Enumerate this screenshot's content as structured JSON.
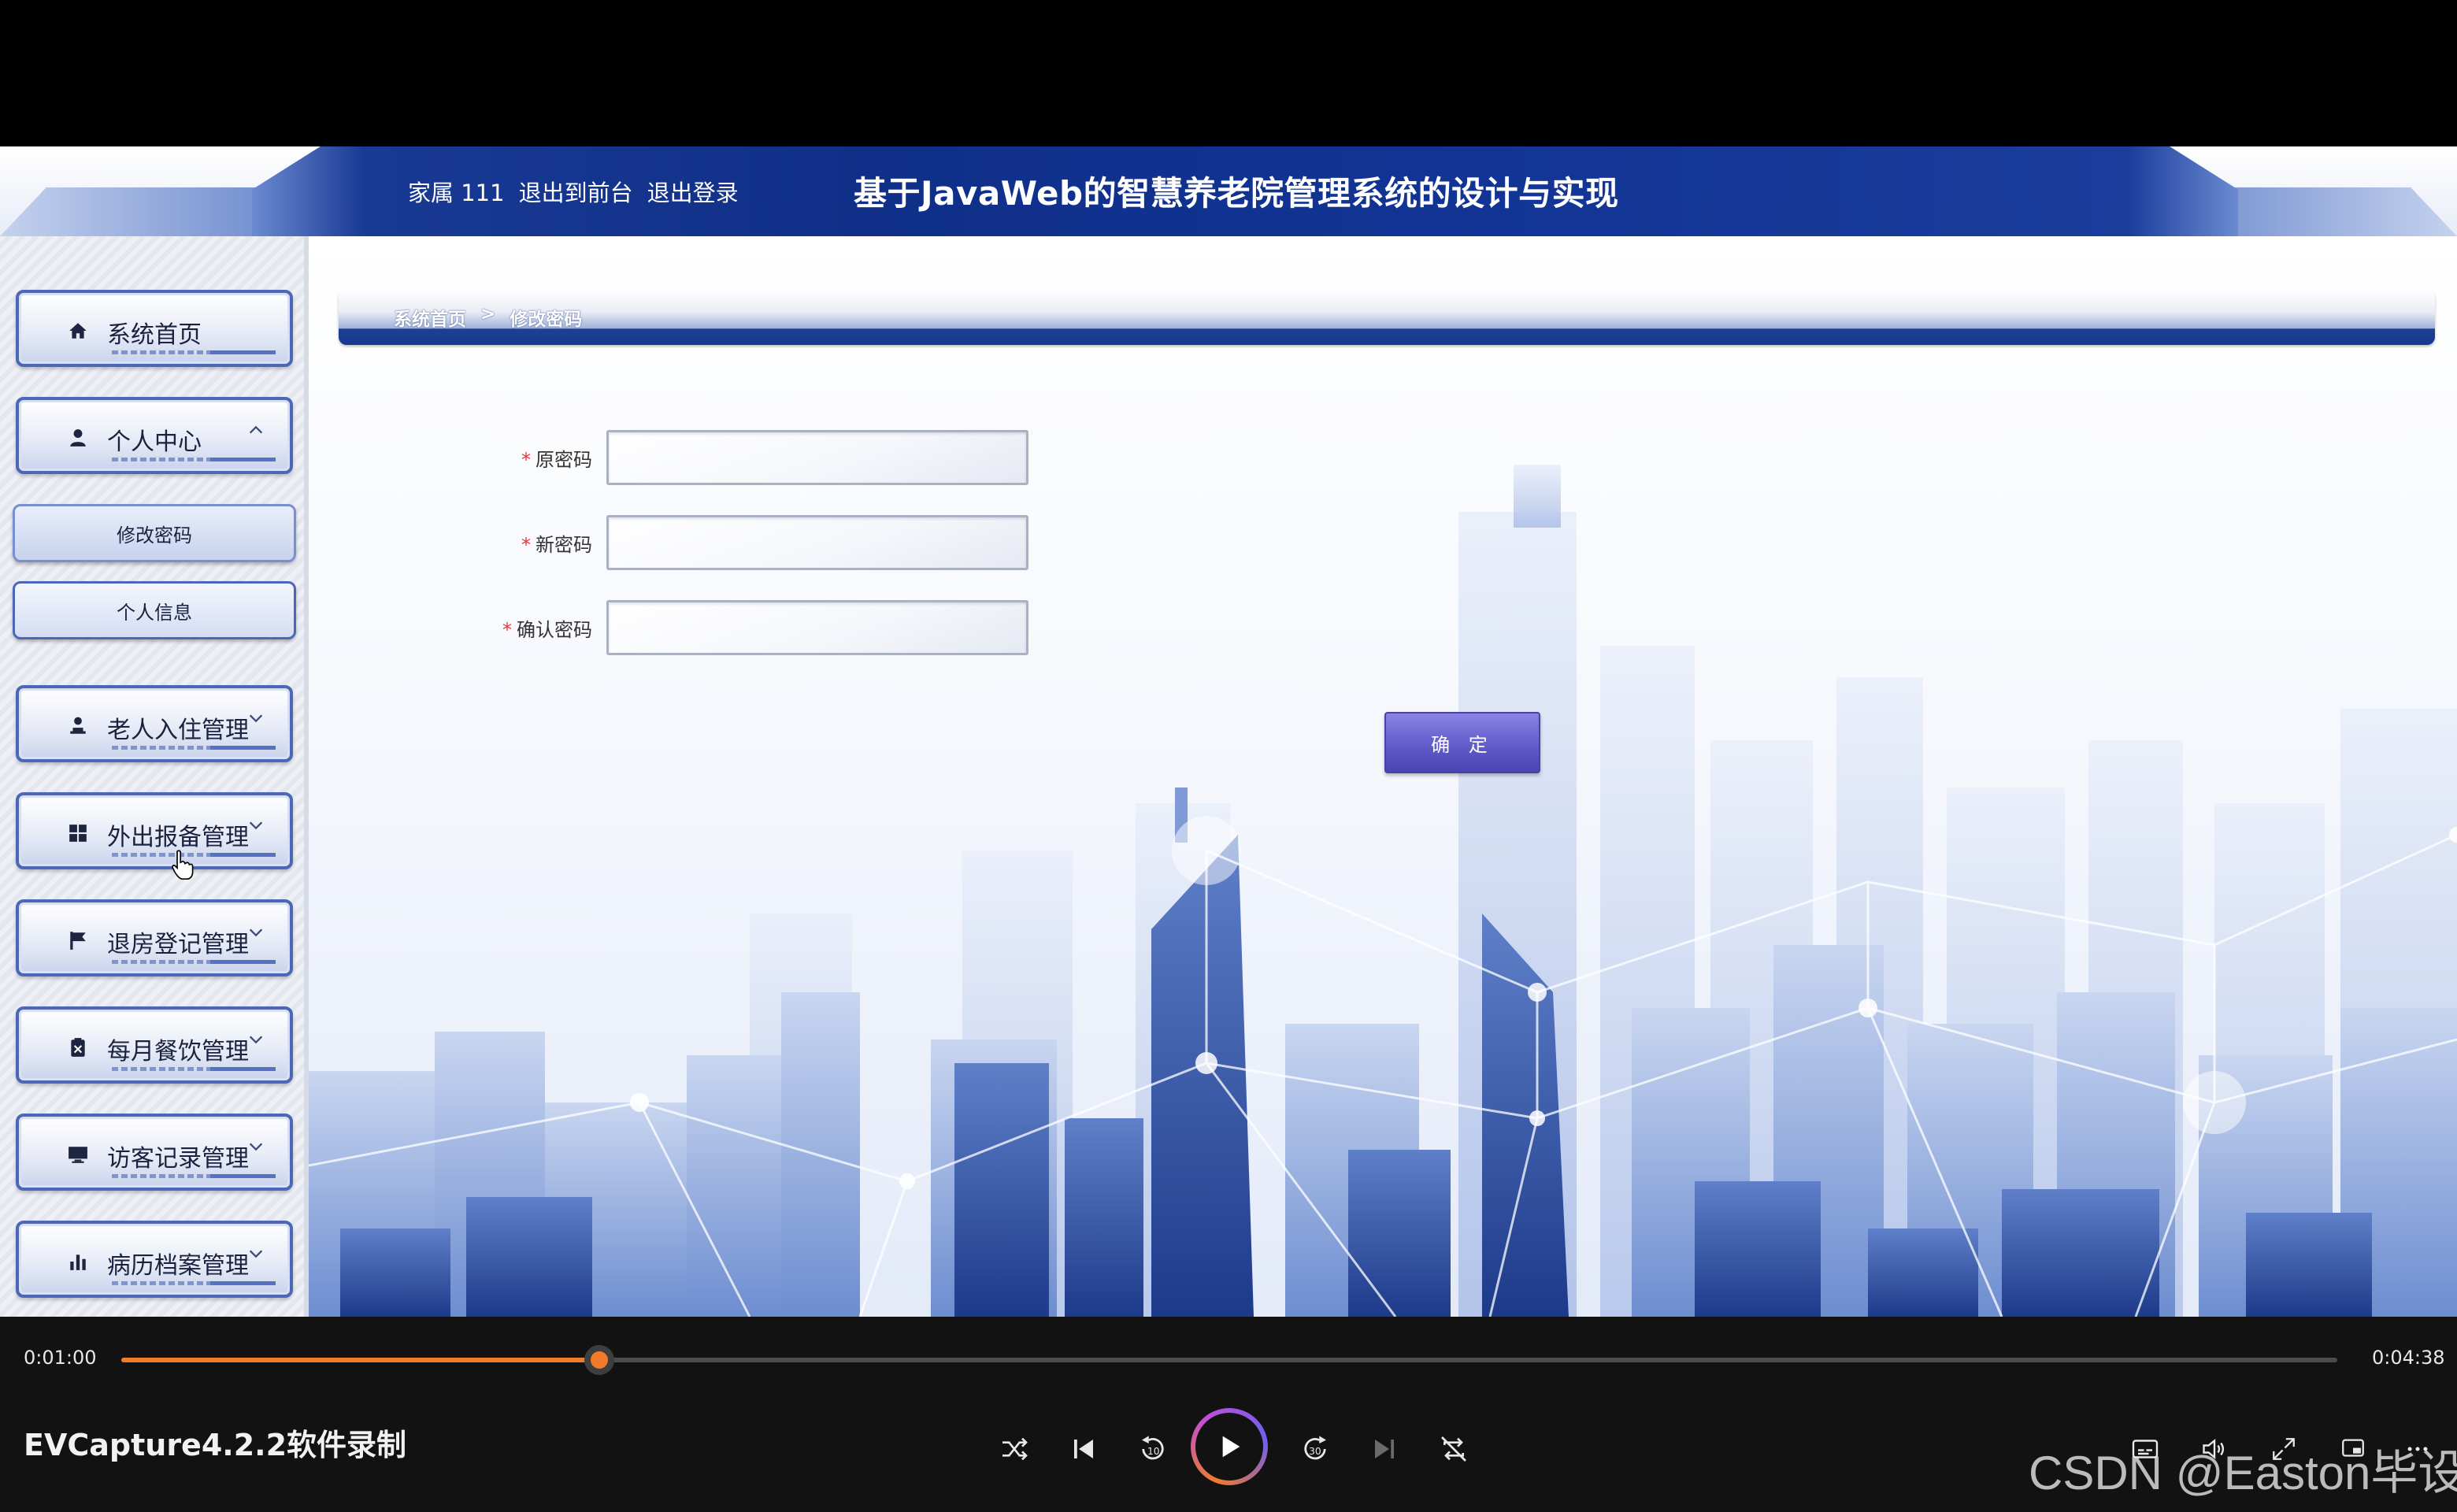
{
  "header": {
    "user_label": "家属 111",
    "back_to_front": "退出到前台",
    "logout": "退出登录",
    "system_title": "基于JavaWeb的智慧养老院管理系统的设计与实现"
  },
  "sidebar": {
    "items": [
      {
        "label": "系统首页",
        "icon": "home-icon",
        "chevron": ""
      },
      {
        "label": "个人中心",
        "icon": "user-icon",
        "chevron": "^"
      },
      {
        "label": "老人入住管理",
        "icon": "person-icon",
        "chevron": "˅"
      },
      {
        "label": "外出报备管理",
        "icon": "grid-icon",
        "chevron": "˅"
      },
      {
        "label": "退房登记管理",
        "icon": "flag-icon",
        "chevron": "˅"
      },
      {
        "label": "每月餐饮管理",
        "icon": "clipboard-icon",
        "chevron": "˅"
      },
      {
        "label": "访客记录管理",
        "icon": "monitor-icon",
        "chevron": "˅"
      },
      {
        "label": "病历档案管理",
        "icon": "bar-chart-icon",
        "chevron": "˅"
      }
    ],
    "sub_items": [
      {
        "label": "修改密码"
      },
      {
        "label": "个人信息"
      }
    ]
  },
  "breadcrumb": {
    "home": "系统首页",
    "separator": ">",
    "current": "修改密码"
  },
  "form": {
    "required_mark": "*",
    "old_password_label": "原密码",
    "new_password_label": "新密码",
    "confirm_password_label": "确认密码",
    "submit_label": "确 定"
  },
  "player": {
    "current_time": "0:01:00",
    "total_time": "0:04:38",
    "progress": 0.2157,
    "title": "EVCapture4.2.2软件录制",
    "accent": "#f07b2a",
    "watermark": "CSDN @Easton毕设"
  }
}
